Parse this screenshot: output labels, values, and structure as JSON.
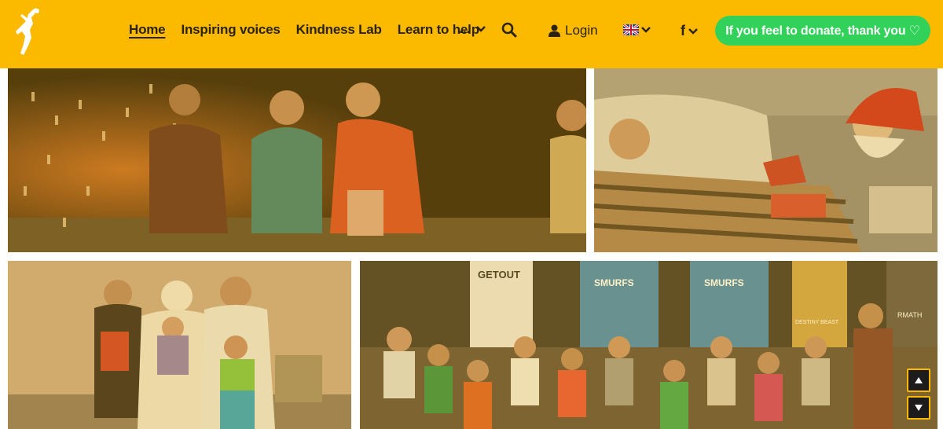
{
  "brand": {
    "accent": "#fbb900",
    "donate_color": "#32d15a",
    "logo_icon": "jumping-figure-logo"
  },
  "nav": {
    "items": [
      {
        "label": "Home",
        "active": true
      },
      {
        "label": "Inspiring voices",
        "active": false
      },
      {
        "label": "Kindness Lab",
        "active": false
      },
      {
        "label": "Learn to help",
        "active": false
      }
    ],
    "more_label": "...",
    "search_icon": "search-icon"
  },
  "account": {
    "login_label": "Login",
    "icon": "user-icon"
  },
  "language": {
    "flag": "uk-flag-icon"
  },
  "social": {
    "facebook_label": "f"
  },
  "donate": {
    "label": "If you feel to donate, thank you ♡"
  },
  "gallery": {
    "tiles": [
      {
        "name": "children-campfire"
      },
      {
        "name": "santa-hospital-visit"
      },
      {
        "name": "family-portrait"
      },
      {
        "name": "cinema-group-hearts"
      }
    ],
    "posters": [
      "GETOUT",
      "SMURFS",
      "SMURFS",
      "DESTINY BEAST",
      "RMATH"
    ]
  },
  "scroll": {
    "up_icon": "arrow-up-icon",
    "down_icon": "arrow-down-icon"
  }
}
